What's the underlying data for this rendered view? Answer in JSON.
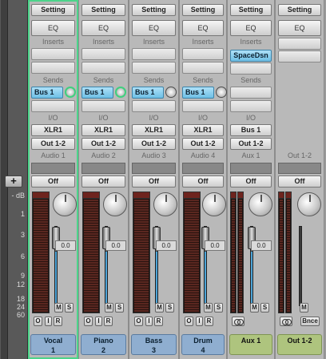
{
  "scale": {
    "unit": "dB",
    "labels": [
      "- dB",
      "1",
      "3",
      "6",
      "9",
      "12",
      "18",
      "24",
      "60"
    ]
  },
  "add_label": "+",
  "section_labels": {
    "eq": "EQ",
    "inserts": "Inserts",
    "sends": "Sends",
    "io": "I/O"
  },
  "strips": [
    {
      "setting": "Setting",
      "eq": "EQ",
      "inserts": "Inserts",
      "insert_slots": [],
      "send": "Bus 1",
      "input": "XLR1",
      "output": "Out 1-2",
      "track": "Audio 1",
      "automation": "Off",
      "volume": "0.0",
      "mute": "M",
      "solo": "S",
      "btn_o": "O",
      "btn_i": "I",
      "btn_r": "R",
      "name_line1": "Vocal",
      "name_line2": "1",
      "selected": true
    },
    {
      "setting": "Setting",
      "eq": "EQ",
      "inserts": "Inserts",
      "insert_slots": [],
      "send": "Bus 1",
      "input": "XLR1",
      "output": "Out 1-2",
      "track": "Audio 2",
      "automation": "Off",
      "volume": "0.0",
      "mute": "M",
      "solo": "S",
      "btn_o": "O",
      "btn_i": "I",
      "btn_r": "R",
      "name_line1": "Piano",
      "name_line2": "2",
      "selected": false
    },
    {
      "setting": "Setting",
      "eq": "EQ",
      "inserts": "Inserts",
      "insert_slots": [],
      "send": "Bus 1",
      "input": "XLR1",
      "output": "Out 1-2",
      "track": "Audio 3",
      "automation": "Off",
      "volume": "0.0",
      "mute": "M",
      "solo": "S",
      "btn_o": "O",
      "btn_i": "I",
      "btn_r": "R",
      "name_line1": "Bass",
      "name_line2": "3",
      "selected": false
    },
    {
      "setting": "Setting",
      "eq": "EQ",
      "inserts": "Inserts",
      "insert_slots": [],
      "send": "Bus 1",
      "input": "XLR1",
      "output": "Out 1-2",
      "track": "Audio 4",
      "automation": "Off",
      "volume": "0.0",
      "mute": "M",
      "solo": "S",
      "btn_o": "O",
      "btn_i": "I",
      "btn_r": "R",
      "name_line1": "Drum",
      "name_line2": "4",
      "selected": false
    },
    {
      "setting": "Setting",
      "eq": "EQ",
      "inserts": "Inserts",
      "insert_slots": [
        "SpaceDsn"
      ],
      "send": "",
      "input": "Bus 1",
      "output": "Out 1-2",
      "track": "Aux 1",
      "automation": "Off",
      "volume": "0.0",
      "mute": "M",
      "solo": "S",
      "name_line1": "Aux 1",
      "name_line2": "",
      "selected": false
    },
    {
      "setting": "Setting",
      "eq": "EQ",
      "inserts": "",
      "insert_slots": [],
      "send": "",
      "input": "",
      "output": "",
      "track": "Out 1-2",
      "automation": "Off",
      "volume": "",
      "mute": "M",
      "solo": "",
      "bnce": "Bnce",
      "name_line1": "Out 1-2",
      "name_line2": "",
      "selected": false
    }
  ],
  "colors": {
    "selection": "#4cd48a",
    "audio_name": "#8faed0",
    "aux_name": "#aec47e",
    "send_blue": "#6fc0e6"
  }
}
